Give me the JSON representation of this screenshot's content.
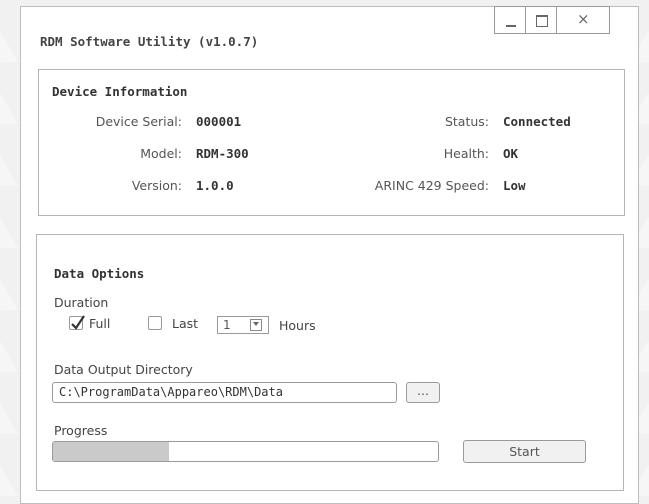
{
  "window": {
    "title": "RDM Software Utility (v1.0.7)",
    "controls": {
      "minimize": "minimize-icon",
      "maximize": "maximize-icon",
      "close": "×"
    }
  },
  "device_info": {
    "heading": "Device Information",
    "serial_label": "Device Serial:",
    "serial_value": "000001",
    "model_label": "Model:",
    "model_value": "RDM-300",
    "version_label": "Version:",
    "version_value": "1.0.0",
    "status_label": "Status:",
    "status_value": "Connected",
    "health_label": "Health:",
    "health_value": "OK",
    "speed_label": "ARINC 429 Speed:",
    "speed_value": "Low"
  },
  "data_options": {
    "heading": "Data Options",
    "duration_label": "Duration",
    "full_label": "Full",
    "full_checked": true,
    "last_label": "Last",
    "last_checked": false,
    "last_amount": "1",
    "hours_label": "Hours",
    "output_dir_label": "Data Output Directory",
    "output_dir_value": "C:\\ProgramData\\Appareo\\RDM\\Data",
    "browse_label": "...",
    "progress_label": "Progress",
    "progress_fraction": 0.3,
    "start_label": "Start"
  }
}
